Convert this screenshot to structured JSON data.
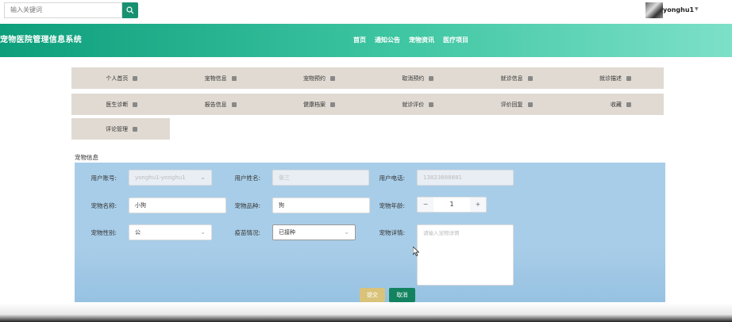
{
  "search": {
    "placeholder": "输入关键词"
  },
  "user": {
    "name": "yonghu1",
    "caret": "▼"
  },
  "site": {
    "title": "宠物医院管理信息系统"
  },
  "nav": [
    "首页",
    "通知公告",
    "宠物资讯",
    "医疗项目"
  ],
  "menu_row1": [
    "个人首页",
    "宠物信息",
    "宠物预约",
    "取消预约",
    "就诊信息",
    "就诊描述"
  ],
  "menu_row2": [
    "医生诊断",
    "报告信息",
    "健康档案",
    "就诊评价",
    "评价回复",
    "收藏"
  ],
  "menu_row3": [
    "评论管理"
  ],
  "form": {
    "section_title": "宠物信息",
    "account_label": "用户账号:",
    "account_value": "yonghu1-yonghu1",
    "username_label": "用户姓名:",
    "username_value": "张三",
    "phone_label": "用户电话:",
    "phone_value": "13823888881",
    "pet_name_label": "宠物名称:",
    "pet_name_value": "小狗",
    "breed_label": "宠物品种:",
    "breed_value": "狗",
    "age_label": "宠物年龄:",
    "age_value": "1",
    "minus": "−",
    "plus": "+",
    "gender_label": "宠物性别:",
    "gender_value": "公",
    "vaccine_label": "疫苗情况:",
    "vaccine_value": "已接种",
    "details_label": "宠物详情:",
    "details_placeholder": "请输入宠物详情",
    "submit_label": "提交",
    "cancel_label": "取消"
  },
  "colors": {
    "accent": "#17916f",
    "panel": "#a8cde8",
    "menu_bg": "#e0dad3",
    "submit": "#d9c37a",
    "cancel": "#13835f"
  }
}
